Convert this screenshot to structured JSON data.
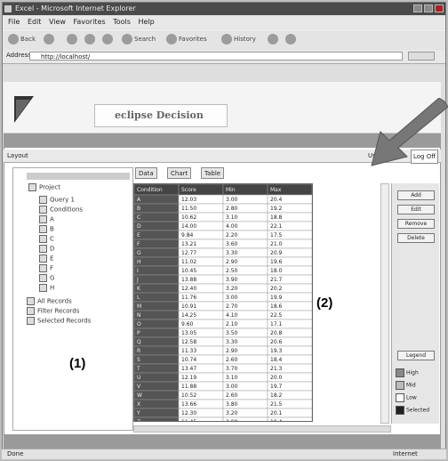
{
  "window": {
    "title": "Excel - Microsoft Internet Explorer"
  },
  "menu": [
    "File",
    "Edit",
    "View",
    "Favorites",
    "Tools",
    "Help"
  ],
  "toolbar": {
    "back": "Back",
    "search": "Search",
    "favorites": "Favorites",
    "history": "History"
  },
  "address": {
    "label": "Address",
    "url": "http://localhost/"
  },
  "banner": {
    "product_name": "eclipse Decision"
  },
  "status_row": {
    "left": "Layout",
    "right": "User: Admin",
    "logout": "Log Off"
  },
  "tree": {
    "root": "Project",
    "items": [
      "Query 1",
      "Conditions",
      "A",
      "B",
      "C",
      "D",
      "E",
      "F",
      "G",
      "H"
    ],
    "extras": [
      "All Records",
      "Filter Records",
      "Selected Records"
    ]
  },
  "tabs": [
    "Data",
    "Chart",
    "Table"
  ],
  "grid": {
    "columns": [
      "Condition",
      "Score",
      "Min",
      "Max"
    ],
    "rows": [
      [
        "A",
        "12.03",
        "3.00",
        "20.4"
      ],
      [
        "B",
        "11.50",
        "2.80",
        "19.2"
      ],
      [
        "C",
        "10.62",
        "3.10",
        "18.8"
      ],
      [
        "D",
        "14.00",
        "4.00",
        "22.1"
      ],
      [
        "E",
        "9.84",
        "2.20",
        "17.5"
      ],
      [
        "F",
        "13.21",
        "3.60",
        "21.0"
      ],
      [
        "G",
        "12.77",
        "3.30",
        "20.9"
      ],
      [
        "H",
        "11.02",
        "2.90",
        "19.6"
      ],
      [
        "I",
        "10.45",
        "2.50",
        "18.0"
      ],
      [
        "J",
        "13.88",
        "3.90",
        "21.7"
      ],
      [
        "K",
        "12.40",
        "3.20",
        "20.2"
      ],
      [
        "L",
        "11.76",
        "3.00",
        "19.9"
      ],
      [
        "M",
        "10.91",
        "2.70",
        "18.6"
      ],
      [
        "N",
        "14.25",
        "4.10",
        "22.5"
      ],
      [
        "O",
        "9.60",
        "2.10",
        "17.1"
      ],
      [
        "P",
        "13.05",
        "3.50",
        "20.8"
      ],
      [
        "Q",
        "12.58",
        "3.30",
        "20.6"
      ],
      [
        "R",
        "11.33",
        "2.90",
        "19.3"
      ],
      [
        "S",
        "10.74",
        "2.60",
        "18.4"
      ],
      [
        "T",
        "13.47",
        "3.70",
        "21.3"
      ],
      [
        "U",
        "12.19",
        "3.10",
        "20.0"
      ],
      [
        "V",
        "11.88",
        "3.00",
        "19.7"
      ],
      [
        "W",
        "10.52",
        "2.60",
        "18.2"
      ],
      [
        "X",
        "13.66",
        "3.80",
        "21.5"
      ],
      [
        "Y",
        "12.30",
        "3.20",
        "20.1"
      ],
      [
        "Z",
        "11.45",
        "2.90",
        "19.4"
      ]
    ]
  },
  "right_panel": {
    "buttons": [
      "Add",
      "Edit",
      "Remove",
      "Delete"
    ],
    "bottom_button": "Legend",
    "legend": [
      "High",
      "Mid",
      "Low",
      "Selected"
    ],
    "colors": [
      "#888888",
      "#bbbbbb",
      "#ffffff",
      "#222222"
    ]
  },
  "statusbar": {
    "left": "Done",
    "right": "Internet"
  },
  "annotations": {
    "one": "(1)",
    "two": "(2)"
  }
}
